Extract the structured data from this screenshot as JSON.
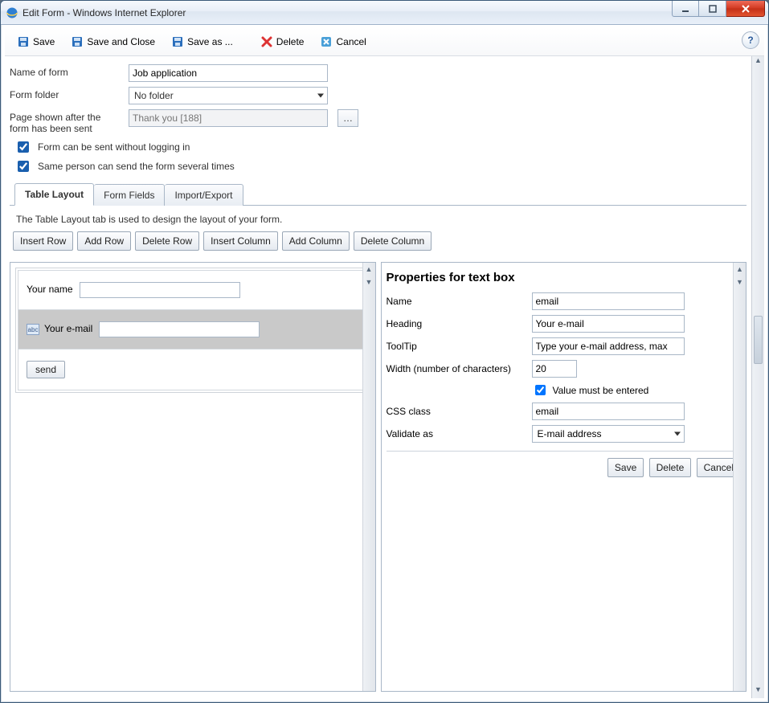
{
  "window": {
    "title": "Edit Form - Windows Internet Explorer"
  },
  "toolbar": {
    "save": "Save",
    "save_close": "Save and Close",
    "save_as": "Save as ...",
    "delete": "Delete",
    "cancel": "Cancel"
  },
  "form_meta": {
    "name_label": "Name of form",
    "name_value": "Job application",
    "folder_label": "Form folder",
    "folder_value": "No folder",
    "aftersend_label": "Page shown after the form has been sent",
    "aftersend_placeholder": "Thank you [188]",
    "chk_anon": "Form can be sent without logging in",
    "chk_multi": "Same person can send the form several times",
    "chk_anon_checked": true,
    "chk_multi_checked": true
  },
  "tabs": {
    "layout": "Table Layout",
    "fields": "Form Fields",
    "import": "Import/Export",
    "active": "layout",
    "desc": "The Table Layout tab is used to design the layout of your form."
  },
  "layout_buttons": {
    "insert_row": "Insert Row",
    "add_row": "Add Row",
    "delete_row": "Delete Row",
    "insert_col": "Insert Column",
    "add_col": "Add Column",
    "delete_col": "Delete Column"
  },
  "preview": {
    "rows": [
      {
        "label": "Your name",
        "has_input": true,
        "selected": false
      },
      {
        "label": "Your e-mail",
        "has_input": true,
        "selected": true,
        "icon": "abc"
      },
      {
        "label": "send",
        "is_button": true,
        "selected": false
      }
    ]
  },
  "props": {
    "title": "Properties for text box",
    "name_label": "Name",
    "name_value": "email",
    "heading_label": "Heading",
    "heading_value": "Your e-mail",
    "tooltip_label": "ToolTip",
    "tooltip_value": "Type your e-mail address, max",
    "width_label": "Width (number of characters)",
    "width_value": "20",
    "required_label": "Value must be entered",
    "required_checked": true,
    "css_label": "CSS class",
    "css_value": "email",
    "validate_label": "Validate as",
    "validate_value": "E-mail address",
    "save": "Save",
    "delete": "Delete",
    "cancel": "Cancel"
  }
}
